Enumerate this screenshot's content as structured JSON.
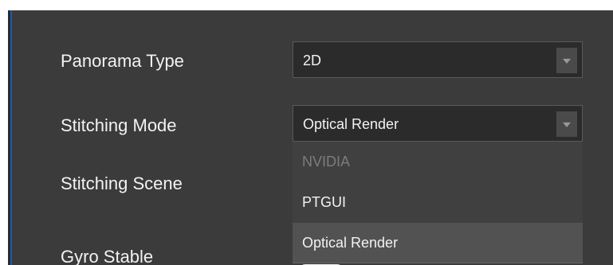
{
  "settings": {
    "panorama_type": {
      "label": "Panorama Type",
      "value": "2D"
    },
    "stitching_mode": {
      "label": "Stitching Mode",
      "value": "Optical Render",
      "options": [
        "NVIDIA",
        "PTGUI",
        "Optical Render"
      ],
      "disabled_options": [
        "NVIDIA"
      ]
    },
    "stitching_scene": {
      "label": "Stitching Scene"
    },
    "gyro_stable": {
      "label": "Gyro Stable"
    }
  },
  "colors": {
    "panel_bg": "#3b3b3b",
    "field_bg": "#2b2b2b",
    "text": "#f2f2f2",
    "disabled_text": "#7c7c7c",
    "accent_edge": "#1e5aa8"
  },
  "icons": {
    "dropdown_arrow": "chevron-down-icon"
  }
}
